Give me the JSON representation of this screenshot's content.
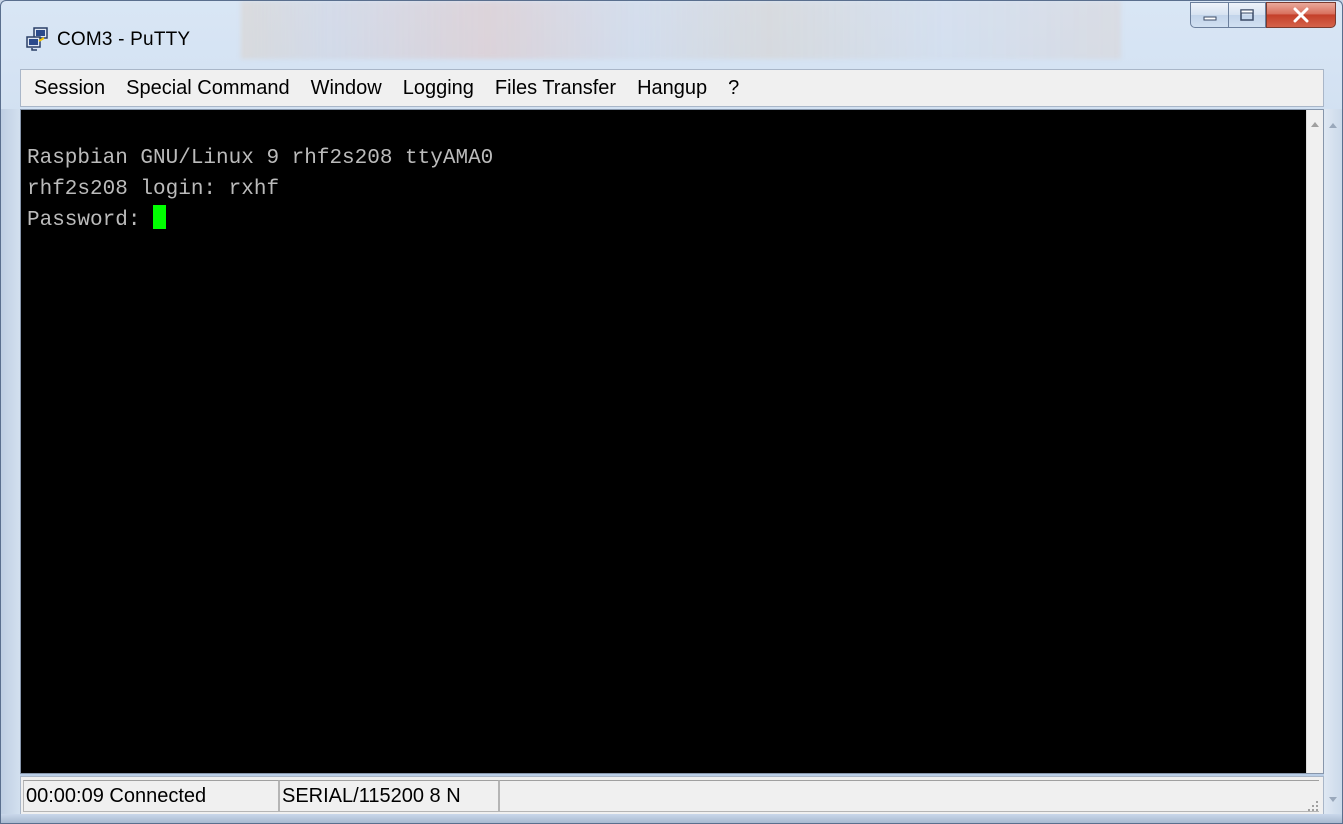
{
  "window": {
    "title": "COM3 - PuTTY",
    "icon": "putty-app-icon"
  },
  "caption_buttons": {
    "minimize_icon": "minimize-icon",
    "maximize_icon": "maximize-icon",
    "close_label": "X"
  },
  "menubar": {
    "items": [
      {
        "label": "Session"
      },
      {
        "label": "Special Command"
      },
      {
        "label": "Window"
      },
      {
        "label": "Logging"
      },
      {
        "label": "Files Transfer"
      },
      {
        "label": "Hangup"
      },
      {
        "label": "?"
      }
    ]
  },
  "terminal": {
    "lines": [
      "Raspbian GNU/Linux 9 rhf2s208 ttyAMA0",
      "rhf2s208 login: rxhf",
      "Password: "
    ],
    "text_color": "#bbbbbb",
    "background": "#000000",
    "cursor_color": "#00ff00"
  },
  "statusbar": {
    "connection": "00:00:09 Connected",
    "serial": "SERIAL/115200 8 N"
  }
}
